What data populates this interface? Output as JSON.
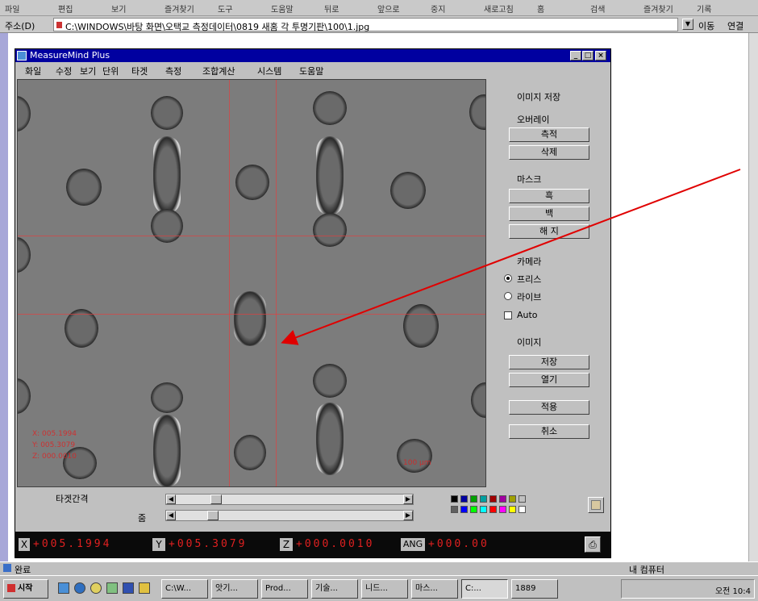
{
  "ie": {
    "menu_items": [
      "파일",
      "편집",
      "보기",
      "즐겨찾기",
      "도구",
      "도움말",
      "뒤로",
      "앞으로",
      "중지",
      "새로고침",
      "홈",
      "검색",
      "즐겨찾기",
      "기록"
    ],
    "address_label": "주소(D)",
    "address_value": "C:\\WINDOWS\\바탕 화면\\오택교   측정데이터\\0819 새홈 각 투명기판\\100\\1.jpg",
    "go_label": "이동",
    "links_label": "연결"
  },
  "app": {
    "title": "MeasureMind Plus",
    "window_buttons": [
      "_",
      "□",
      "×"
    ],
    "menu": [
      "화일",
      "수정",
      "보기",
      "단위",
      "타겟",
      "측정",
      "조합계산",
      "시스템",
      "도움말"
    ]
  },
  "panel": {
    "save_image": "이미지 저장",
    "overlay_label": "오버레이",
    "overlay_buttons": [
      "측적",
      "삭제"
    ],
    "mask_label": "마스크",
    "mask_buttons": [
      "흑",
      "백",
      "해 지"
    ],
    "camera_label": "카메라",
    "camera_options": [
      "프리스",
      "라이브"
    ],
    "camera_selected": "프리스",
    "auto_label": "Auto",
    "image_label": "이미지",
    "image_buttons": [
      "저장",
      "열기"
    ],
    "apply_button": "적용",
    "cancel_button": "취소"
  },
  "viewport": {
    "overlay_lines": [
      "X: 005.1994",
      "Y: 005.3079",
      "Z: 000.0010"
    ],
    "scale_text": "100 µm"
  },
  "sliders": {
    "target_interval_label": "타겟간격",
    "second_label": "줌"
  },
  "palette": [
    "#000000",
    "#0000a0",
    "#00a000",
    "#00a0a0",
    "#a00000",
    "#a000a0",
    "#a0a000",
    "#c0c0c0",
    "#606060",
    "#0000ff",
    "#00ff00",
    "#00ffff",
    "#ff0000",
    "#ff00ff",
    "#ffff00",
    "#ffffff"
  ],
  "readout": {
    "x_label": "X",
    "x_value": "+005.1994",
    "y_label": "Y",
    "y_value": "+005.3079",
    "z_label": "Z",
    "z_value": "+000.0010",
    "ang_label": "ANG",
    "ang_value": "+000.00"
  },
  "status": {
    "left": "완료",
    "right": "내 컴퓨터"
  },
  "taskbar": {
    "start": "시작",
    "tasks": [
      "C:\\W...",
      "앗기...",
      "Prod...",
      "기술...",
      "니드...",
      "마스...",
      "C:...",
      "1889"
    ],
    "active_task": 6,
    "clock": "오전 10:4"
  },
  "colors": {
    "accent": "#0000a0",
    "overlay_red": "#e04040",
    "readout_red": "#e02020",
    "arrow": "#e00000"
  }
}
